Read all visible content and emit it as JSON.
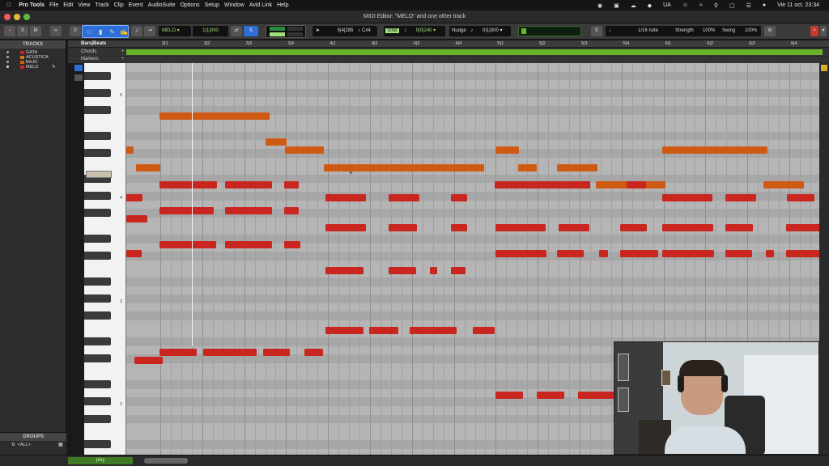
{
  "menubar": {
    "items": [
      "Pro Tools",
      "File",
      "Edit",
      "View",
      "Track",
      "Clip",
      "Event",
      "AudioSuite",
      "Options",
      "Setup",
      "Window",
      "Avid Link",
      "Help"
    ],
    "input_source": "UA",
    "datetime": "Vie 11 oct.  23:34"
  },
  "window": {
    "title": "MIDI Editor: \"MELO\" and one other track"
  },
  "toolbar": {
    "track_name": "MELO",
    "position_display": "1|1|000",
    "grid_label": "Grid",
    "grid_value": "0|0|240",
    "nudge_label": "Nudge",
    "nudge_value": "0|1|000",
    "counter": "5|4|285",
    "note_name": "C#4",
    "quantize_value": "1/16 note",
    "strength_label": "Strength",
    "strength_value": "100%",
    "swing_label": "Swing",
    "swing_value": "100%"
  },
  "tracks_panel": {
    "header": "TRACKS",
    "tracks": [
      {
        "name": "GATA",
        "color": "#c8261f"
      },
      {
        "name": "ACUSTICA",
        "color": "#d07a16"
      },
      {
        "name": "BAJO",
        "color": "#cf5a14"
      },
      {
        "name": "MELO",
        "color": "#c8261f"
      }
    ]
  },
  "groups_panel": {
    "header": "GROUPS",
    "item": "<ALL>"
  },
  "rulers": {
    "bars_beats_label": "Bars|Beats",
    "chords_label": "Chords",
    "markers_label": "Markers",
    "bar_labels": [
      "3|1",
      "3|2",
      "3|3",
      "3|4",
      "4|1",
      "4|2",
      "4|3",
      "4|4",
      "5|1",
      "5|2",
      "5|3",
      "5|4",
      "6|1",
      "6|2",
      "6|3",
      "6|4"
    ]
  },
  "piano": {
    "octave_labels": [
      "5",
      "4",
      "3",
      "2"
    ]
  },
  "bottombar": {
    "play_label": "play"
  },
  "colors": {
    "note_red": "#c8261f",
    "note_orange": "#cf5a14",
    "selection_green": "#6ab32d"
  }
}
